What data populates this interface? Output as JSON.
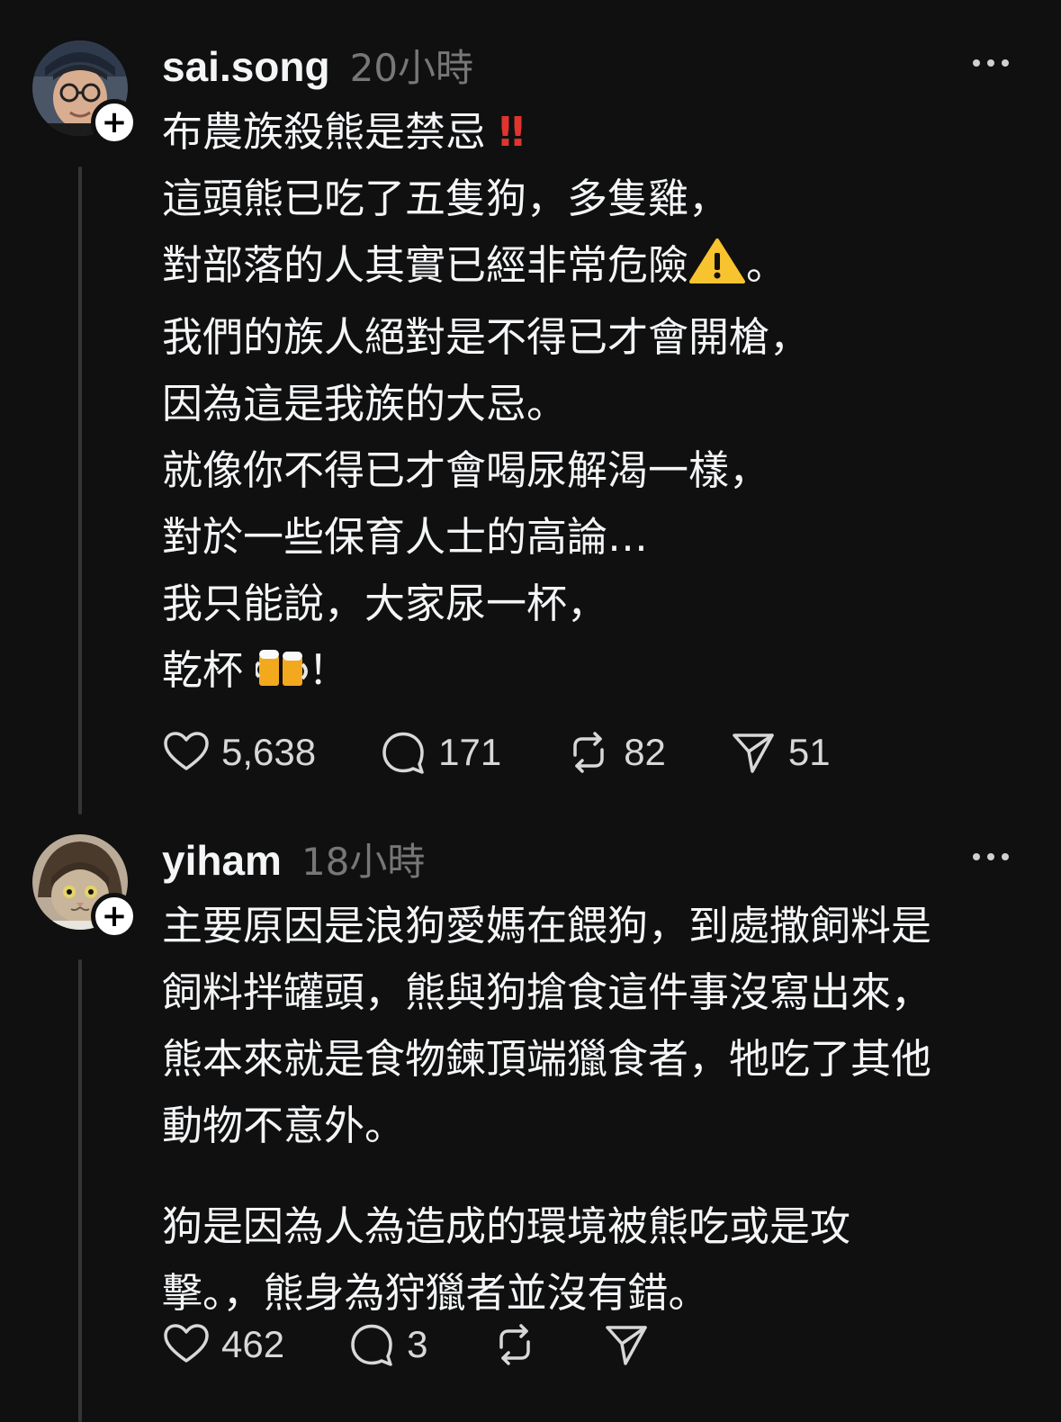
{
  "posts": [
    {
      "username": "sai.song",
      "timestamp": "20小時",
      "avatar_icon": "person-with-glasses-avatar",
      "lines": [
        "布農族殺熊是禁忌",
        "這頭熊已吃了五隻狗，多隻雞，",
        "對部落的人其實已經非常危險",
        "我們的族人絕對是不得已才會開槍，",
        "因為這是我族的大忌。",
        "就像你不得已才會喝尿解渴一樣，",
        "對於一些保育人士的高論…",
        "我只能說，大家尿一杯，",
        "乾杯"
      ],
      "line1_emoji": "‼",
      "line3_suffix": "。",
      "line9_suffix": "！",
      "likes": "5,638",
      "replies": "171",
      "reposts": "82",
      "shares": "51"
    },
    {
      "username": "yiham",
      "timestamp": "18小時",
      "avatar_icon": "cat-avatar",
      "lines": [
        "主要原因是浪狗愛媽在餵狗，到處撒飼料是",
        "飼料拌罐頭，熊與狗搶食這件事沒寫出來，",
        "熊本來就是食物鍊頂端獵食者，牠吃了其他",
        "動物不意外。"
      ],
      "lines2": [
        "狗是因為人為造成的環境被熊吃或是攻",
        "擊。，熊身為狩獵者並沒有錯。"
      ],
      "likes": "462",
      "replies": "3"
    }
  ],
  "colors": {
    "background": "#101010",
    "text": "#f3f5f7",
    "muted": "#777777",
    "thread_line": "#333638"
  }
}
